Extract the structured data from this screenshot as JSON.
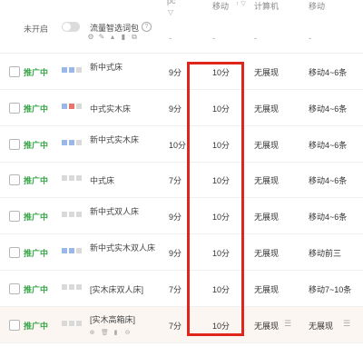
{
  "header": {
    "status_label": "未开启",
    "pack_label": "流量智选词包",
    "help_icon": "?",
    "pack_tools": [
      "gear-icon",
      "edit-icon",
      "chart-icon",
      "bar-icon",
      "copy-icon"
    ],
    "col_pc_partial": "pc",
    "col_mobile": "移动",
    "sort_icons": "↑ ▽",
    "filter_left": "▽",
    "col_computer": "计算机",
    "col_mobile_rank": "移动",
    "dashes": [
      "-",
      "-",
      "-",
      "-"
    ]
  },
  "rows": [
    {
      "state": "推广中",
      "name": "新中式床",
      "name_offset": 0,
      "score": "9分",
      "mobile": "10分",
      "pc": "无展现",
      "mobile_rank": "移动4~6条",
      "squares": [
        "#9bb7e8",
        "#9bb7e8",
        "#d9d9d9"
      ],
      "highlight": false,
      "show_tools": false,
      "pc_filter": false,
      "rank_filter": false
    },
    {
      "state": "推广中",
      "name": "中式实木床",
      "name_offset": 1,
      "score": "9分",
      "mobile": "10分",
      "pc": "无展现",
      "mobile_rank": "移动4~6条",
      "squares": [
        "#9bb7e8",
        "#e8746a",
        "#d9d9d9"
      ],
      "highlight": false,
      "show_tools": false,
      "pc_filter": false,
      "rank_filter": false
    },
    {
      "state": "推广中",
      "name": "新中式实木床",
      "name_offset": 0,
      "score": "10分",
      "mobile": "10分",
      "pc": "无展现",
      "mobile_rank": "移动4~6条",
      "squares": [
        "#9bb7e8",
        "#9bb7e8",
        "#d9d9d9"
      ],
      "highlight": false,
      "show_tools": false,
      "pc_filter": false,
      "rank_filter": false
    },
    {
      "state": "推广中",
      "name": "中式床",
      "name_offset": 1,
      "score": "7分",
      "mobile": "10分",
      "pc": "无展现",
      "mobile_rank": "移动4~6条",
      "squares": [
        "#d9d9d9",
        "#d9d9d9",
        "#d9d9d9"
      ],
      "highlight": false,
      "show_tools": false,
      "pc_filter": false,
      "rank_filter": false
    },
    {
      "state": "推广中",
      "name": "新中式双人床",
      "name_offset": 0,
      "score": "9分",
      "mobile": "10分",
      "pc": "无展现",
      "mobile_rank": "移动4~6条",
      "squares": [
        "#d9d9d9",
        "#d9d9d9",
        "#d9d9d9"
      ],
      "highlight": false,
      "show_tools": false,
      "pc_filter": false,
      "rank_filter": false
    },
    {
      "state": "推广中",
      "name": "新中式实木双人床",
      "name_offset": 0,
      "score": "9分",
      "mobile": "10分",
      "pc": "无展现",
      "mobile_rank": "移动前三",
      "squares": [
        "#9bb7e8",
        "#9bb7e8",
        "#d9d9d9"
      ],
      "highlight": false,
      "show_tools": false,
      "pc_filter": false,
      "rank_filter": false
    },
    {
      "state": "推广中",
      "name": "[实木床双人床]",
      "name_offset": 1,
      "score": "7分",
      "mobile": "10分",
      "pc": "无展现",
      "mobile_rank": "移动7~10条",
      "squares": [
        "#d9d9d9",
        "#d9d9d9",
        "#d9d9d9"
      ],
      "highlight": false,
      "show_tools": false,
      "pc_filter": false,
      "rank_filter": false
    },
    {
      "state": "推广中",
      "name": "[实木高箱床]",
      "name_offset": 0,
      "score": "7分",
      "mobile": "10分",
      "pc": "无展现",
      "mobile_rank": "无展现",
      "squares": [
        "#d9d9d9",
        "#d9d9d9",
        "#d9d9d9"
      ],
      "highlight": true,
      "show_tools": true,
      "pc_filter": true,
      "rank_filter": true
    }
  ],
  "row_tools": [
    "target-icon",
    "delete-icon",
    "chart-icon",
    "zoom-out-icon"
  ],
  "colors": {
    "state_green": "#3aa64a",
    "highlight_box": "#e0251b",
    "highlight_row": "#fbf6f2"
  }
}
